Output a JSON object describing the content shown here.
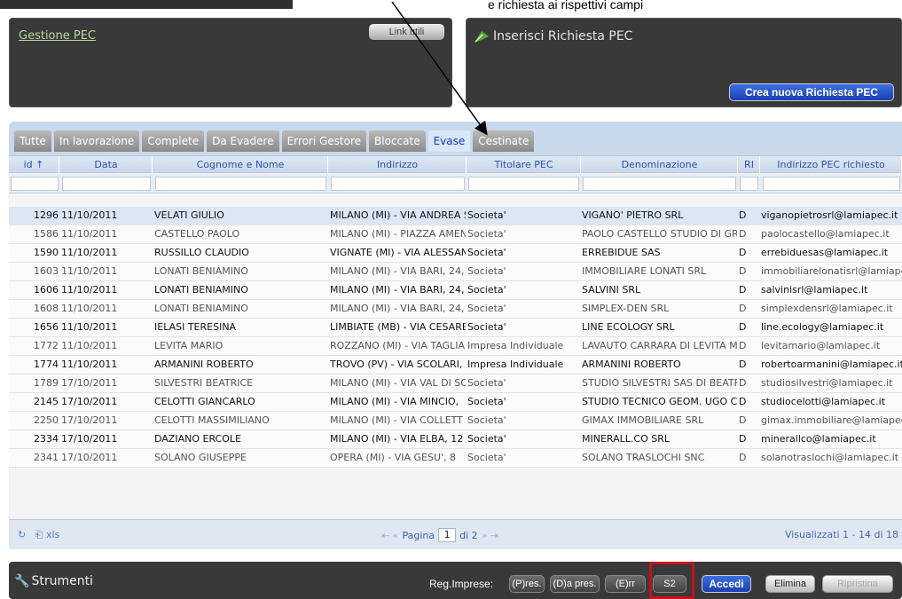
{
  "annotation": {
    "top_text": "e richiesta ai rispettivi campi"
  },
  "gestione": {
    "title": "Gestione PEC",
    "link_label": "Link utili"
  },
  "richiesta": {
    "title": "Inserisci Richiesta PEC",
    "create_label": "Crea nuova Richiesta PEC"
  },
  "tabs": [
    "Tutte",
    "In lavorazione",
    "Complete",
    "Da Evadere",
    "Errori Gestore",
    "Bloccate",
    "Evase",
    "Cestinate"
  ],
  "active_tab": "Evase",
  "columns": [
    "id ↑",
    "Data",
    "Cognome e Nome",
    "Indirizzo",
    "Titolare PEC",
    "Denominazione",
    "RI",
    "Indirizzo PEC richiesto"
  ],
  "rows": [
    {
      "id": "1296",
      "data": "11/10/2011",
      "nome": "VELATI GIULIO",
      "ind": "MILANO (MI) - VIA ANDREA S",
      "tit": "Societa'",
      "den": "VIGANO' PIETRO SRL",
      "ri": "D",
      "pec": "viganopietrosrl@lamiapec.it"
    },
    {
      "id": "1586",
      "data": "11/10/2011",
      "nome": "CASTELLO PAOLO",
      "ind": "MILANO (MI) - PIAZZA AMEN",
      "tit": "Societa'",
      "den": "PAOLO CASTELLO STUDIO DI GR",
      "ri": "D",
      "pec": "paolocastello@lamiapec.it"
    },
    {
      "id": "1590",
      "data": "11/10/2011",
      "nome": "RUSSILLO CLAUDIO",
      "ind": "VIGNATE (MI) - VIA ALESSAN",
      "tit": "Societa'",
      "den": "ERREBIDUE SAS",
      "ri": "D",
      "pec": "errebiduesas@lamiapec.it"
    },
    {
      "id": "1603",
      "data": "11/10/2011",
      "nome": "LONATI BENIAMINO",
      "ind": "MILANO (MI) - VIA BARI, 24,",
      "tit": "Societa'",
      "den": "IMMOBILIARE LONATI SRL",
      "ri": "D",
      "pec": "immobiliarelonatisrl@lamiapec"
    },
    {
      "id": "1606",
      "data": "11/10/2011",
      "nome": "LONATI BENIAMINO",
      "ind": "MILANO (MI) - VIA BARI, 24,",
      "tit": "Societa'",
      "den": "SALVINI SRL",
      "ri": "D",
      "pec": "salvinisrl@lamiapec.it"
    },
    {
      "id": "1608",
      "data": "11/10/2011",
      "nome": "LONATI BENIAMINO",
      "ind": "MILANO (MI) - VIA BARI, 24,",
      "tit": "Societa'",
      "den": "SIMPLEX-DEN SRL",
      "ri": "D",
      "pec": "simplexdensrl@lamiapec.it"
    },
    {
      "id": "1656",
      "data": "11/10/2011",
      "nome": "IELASI TERESINA",
      "ind": "LIMBIATE (MB) - VIA CESARE",
      "tit": "Societa'",
      "den": "LINE ECOLOGY SRL",
      "ri": "D",
      "pec": "line.ecology@lamiapec.it"
    },
    {
      "id": "1772",
      "data": "11/10/2011",
      "nome": "LEVITA MARIO",
      "ind": "ROZZANO (MI) - VIA TAGLIA",
      "tit": "Impresa Individuale",
      "den": "LAVAUTO CARRARA DI LEVITA M",
      "ri": "D",
      "pec": "levitamario@lamiapec.it"
    },
    {
      "id": "1774",
      "data": "11/10/2011",
      "nome": "ARMANINI ROBERTO",
      "ind": "TROVO (PV) - VIA SCOLARI,",
      "tit": "Impresa Individuale",
      "den": "ARMANINI ROBERTO",
      "ri": "D",
      "pec": "robertoarmanini@lamiapec.it"
    },
    {
      "id": "1789",
      "data": "17/10/2011",
      "nome": "SILVESTRI BEATRICE",
      "ind": "MILANO (MI) - VIA VAL DI SO",
      "tit": "Societa'",
      "den": "STUDIO SILVESTRI SAS DI BEATRI",
      "ri": "D",
      "pec": "studiosilvestri@lamiapec.it"
    },
    {
      "id": "2145",
      "data": "17/10/2011",
      "nome": "CELOTTI GIANCARLO",
      "ind": "MILANO (MI) - VIA MINCIO,",
      "tit": "Societa'",
      "den": "STUDIO TECNICO GEOM. UGO C",
      "ri": "D",
      "pec": "studiocelotti@lamiapec.it"
    },
    {
      "id": "2250",
      "data": "17/10/2011",
      "nome": "CELOTTI MASSIMILIANO",
      "ind": "MILANO (MI) - VIA COLLETT",
      "tit": "Societa'",
      "den": "GIMAX IMMOBILIARE SRL",
      "ri": "D",
      "pec": "gimax.immobiliare@lamiapec."
    },
    {
      "id": "2334",
      "data": "17/10/2011",
      "nome": "DAZIANO ERCOLE",
      "ind": "MILANO (MI) - VIA ELBA, 12",
      "tit": "Societa'",
      "den": "MINERALL.CO SRL",
      "ri": "D",
      "pec": "minerallco@lamiapec.it"
    },
    {
      "id": "2341",
      "data": "17/10/2011",
      "nome": "SOLANO GIUSEPPE",
      "ind": "OPERA (MI) - VIA GESU', 8",
      "tit": "Societa'",
      "den": "SOLANO TRASLOCHI SNC",
      "ri": "D",
      "pec": "solanotraslochi@lamiapec.it"
    }
  ],
  "pager": {
    "export": "xls",
    "page_label": "Pagina",
    "page": "1",
    "of_label": "di 2",
    "summary": "Visualizzati 1 - 14 di 18"
  },
  "bottom": {
    "tools_label": "Strumenti",
    "reg_label": "Reg.Imprese:",
    "pres": "(P)res.",
    "dapres": "(D)a pres.",
    "err": "(E)rr",
    "s2": "S2",
    "accedi": "Accedi",
    "elimina": "Elimina",
    "ripristina": "Ripristina"
  },
  "colors": {
    "accent_blue": "#1c3fb0",
    "highlight_red": "#c8101b",
    "panel_dark": "#393939"
  }
}
